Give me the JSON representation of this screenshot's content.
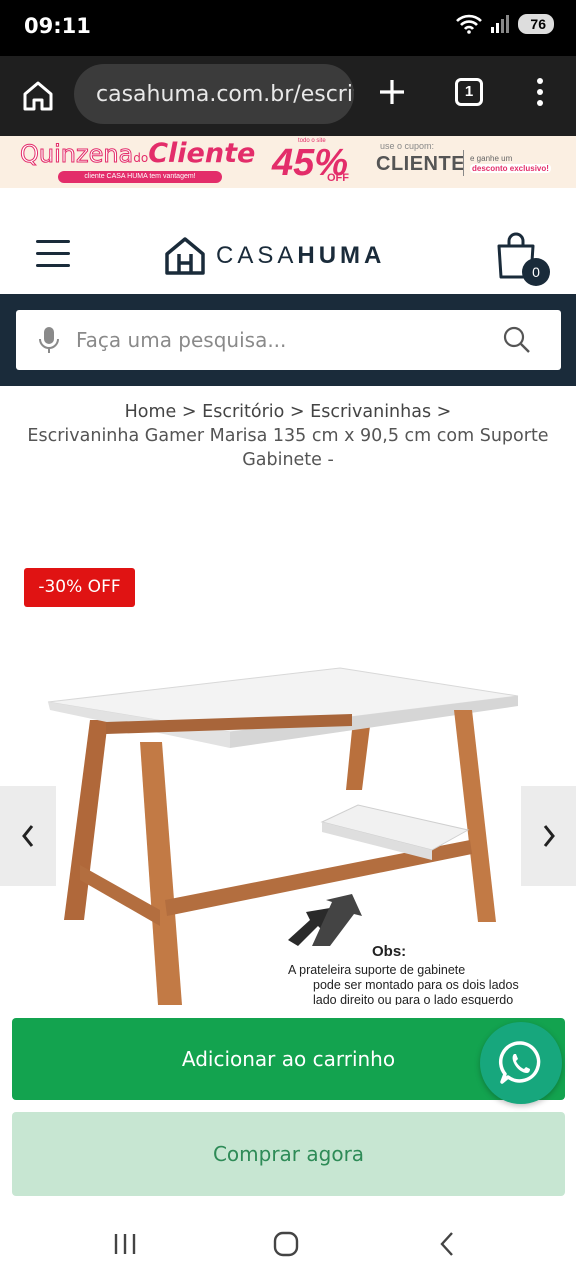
{
  "status_bar": {
    "time": "09:11",
    "battery": "76"
  },
  "browser": {
    "url": "casahuma.com.br/escritorio",
    "tab_count": "1"
  },
  "promo": {
    "line1_a": "Quinzena",
    "line1_de": "do",
    "line1_b": "Cliente",
    "sub": "cliente CASA HUMA tem vantagem!",
    "todos": "todo o site",
    "percent": "45%",
    "off": "OFF",
    "use_coupon": "use o cupom:",
    "coupon_code": "CLIENTE",
    "ganhe": "e ganhe um",
    "desconto": "desconto exclusivo!"
  },
  "header": {
    "logo_light": "CASA",
    "logo_bold": "HUMA",
    "cart_count": "0"
  },
  "search": {
    "placeholder": "Faça uma pesquisa..."
  },
  "breadcrumb": {
    "items": [
      "Home",
      "Escritório",
      "Escrivaninhas"
    ],
    "separator": ">",
    "current": "Escrivaninha Gamer Marisa 135 cm x 90,5 cm com Suporte Gabinete -"
  },
  "product": {
    "discount_badge": "-30% OFF",
    "obs_title": "Obs:",
    "obs_lines": [
      "A prateleira suporte de gabinete",
      "pode ser montado para os dois lados",
      "lado direito ou para o lado esquerdo"
    ]
  },
  "actions": {
    "add_to_cart": "Adicionar ao carrinho",
    "buy_now": "Comprar agora"
  },
  "colors": {
    "navy": "#1a2b3a",
    "green": "#13a34f",
    "light_green": "#c7e6d2",
    "discount_red": "#e01313",
    "promo_pink": "#e32d6a",
    "whatsapp": "#17a77d"
  },
  "icons": [
    "home-icon",
    "tune-icon",
    "plus-icon",
    "more-vert-icon",
    "menu-icon",
    "house-logo-icon",
    "cart-icon",
    "mic-icon",
    "search-icon",
    "chevron-left-icon",
    "chevron-right-icon",
    "whatsapp-icon",
    "recents-icon",
    "home-nav-icon",
    "back-icon"
  ]
}
